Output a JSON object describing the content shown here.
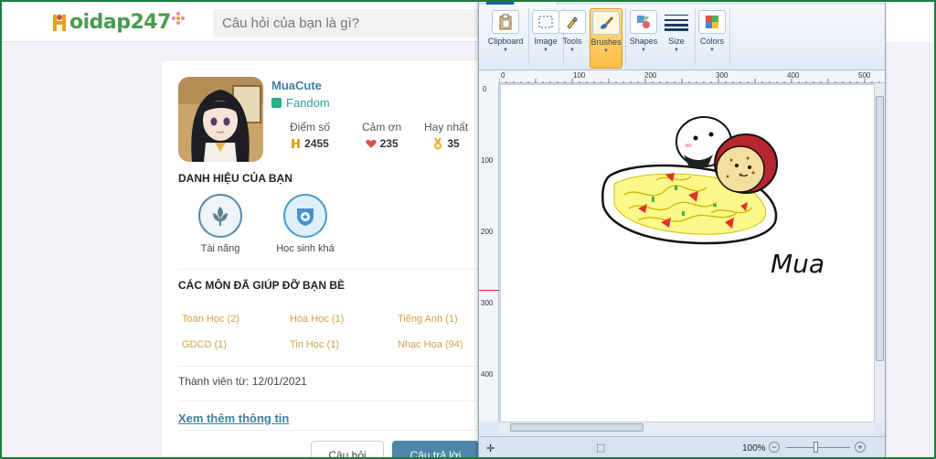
{
  "site": {
    "logo_text": "oidap247",
    "search_placeholder": "Câu hỏi của bạn là gì?"
  },
  "profile": {
    "username": "MuaCute",
    "rank": "Fandom",
    "stats": [
      {
        "label": "Điểm số",
        "value": "2455",
        "icon": "points-icon"
      },
      {
        "label": "Cảm ơn",
        "value": "235",
        "icon": "heart-icon"
      },
      {
        "label": "Hay nhất",
        "value": "35",
        "icon": "medal-icon"
      }
    ],
    "titles_heading": "DANH HIỆU CỦA BẠN",
    "titles": [
      "Tài năng",
      "Học sinh khá"
    ],
    "subjects_heading": "CÁC MÔN ĐÃ GIÚP ĐỠ BẠN BÈ",
    "subjects": [
      "Toán Học (2)",
      "Hóa Học (1)",
      "Tiếng Anh (1)",
      "GDCD (1)",
      "Tin Học (1)",
      "Nhạc Họa (94)"
    ],
    "member_since": "Thành viên từ: 12/01/2021",
    "more_info": "Xem thêm thông tin",
    "tab_questions": "Câu hỏi",
    "tab_answers": "Câu trả lời",
    "colors": {
      "link": "#3e7fa3",
      "subject": "#d4a14b",
      "accent": "#4d86a8"
    }
  },
  "paint": {
    "tools": [
      "Clipboard",
      "Image",
      "Tools",
      "Brushes",
      "Shapes",
      "Size",
      "Colors"
    ],
    "active_tool": "Brushes",
    "ruler_h": [
      "0",
      "100",
      "200",
      "300",
      "400",
      "500"
    ],
    "ruler_v": [
      "0",
      "100",
      "200",
      "300",
      "400"
    ],
    "zoom": "100%",
    "signature": "Mua"
  }
}
